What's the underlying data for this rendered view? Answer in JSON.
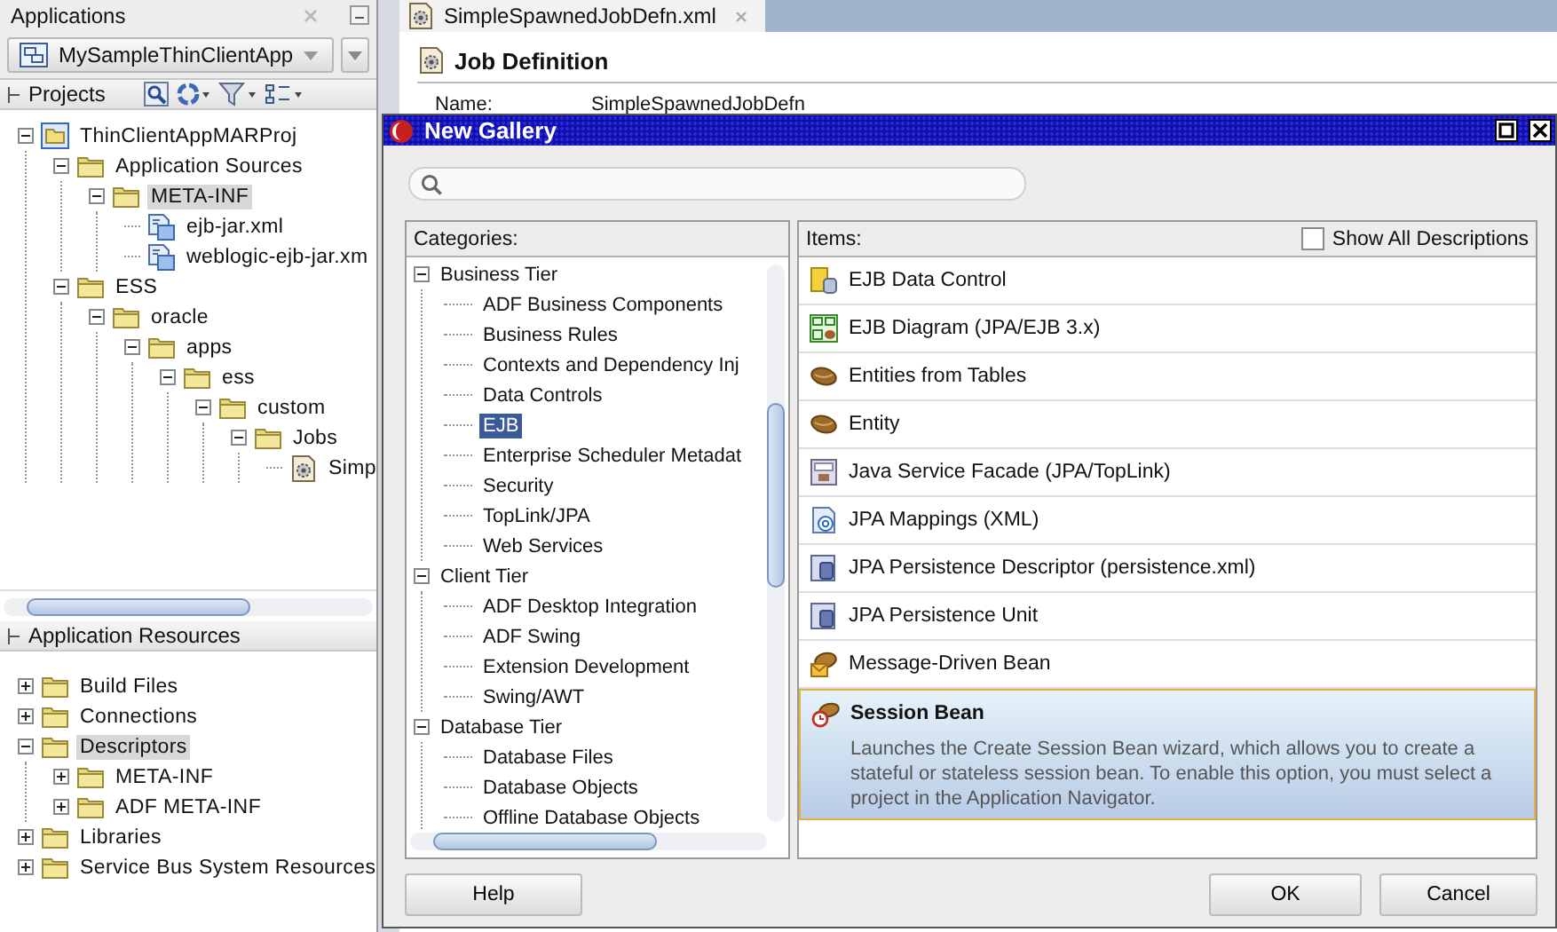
{
  "navigator": {
    "title": "Applications",
    "application": "MySampleThinClientApp",
    "projects_label": "Projects",
    "project_tree": [
      {
        "label": "ThinClientAppMARProj",
        "kind": "project",
        "expanded": true,
        "selected": false,
        "children": [
          {
            "label": "Application Sources",
            "kind": "folder",
            "expanded": true,
            "selected": false,
            "children": [
              {
                "label": "META-INF",
                "kind": "folder",
                "expanded": true,
                "selected": true,
                "children": [
                  {
                    "label": "ejb-jar.xml",
                    "kind": "xml",
                    "selected": false
                  },
                  {
                    "label": "weblogic-ejb-jar.xm",
                    "kind": "xml",
                    "selected": false
                  }
                ]
              }
            ]
          },
          {
            "label": "ESS",
            "kind": "folder",
            "expanded": true,
            "selected": false,
            "children": [
              {
                "label": "oracle",
                "kind": "folder",
                "expanded": true,
                "selected": false,
                "children": [
                  {
                    "label": "apps",
                    "kind": "folder",
                    "expanded": true,
                    "selected": false,
                    "children": [
                      {
                        "label": "ess",
                        "kind": "folder",
                        "expanded": true,
                        "selected": false,
                        "children": [
                          {
                            "label": "custom",
                            "kind": "folder",
                            "expanded": true,
                            "selected": false,
                            "children": [
                              {
                                "label": "Jobs",
                                "kind": "folder",
                                "expanded": true,
                                "selected": false,
                                "children": [
                                  {
                                    "label": "Simp",
                                    "kind": "job",
                                    "selected": false
                                  }
                                ]
                              }
                            ]
                          }
                        ]
                      }
                    ]
                  }
                ]
              }
            ]
          }
        ]
      }
    ],
    "resources_label": "Application Resources",
    "resource_tree": [
      {
        "label": "Build Files",
        "kind": "folder",
        "expanded": false,
        "selected": false
      },
      {
        "label": "Connections",
        "kind": "folder",
        "expanded": false,
        "selected": false
      },
      {
        "label": "Descriptors",
        "kind": "folder",
        "expanded": true,
        "selected": true,
        "children": [
          {
            "label": "META-INF",
            "kind": "folder",
            "expanded": false,
            "selected": false
          },
          {
            "label": "ADF META-INF",
            "kind": "folder",
            "expanded": false,
            "selected": false
          }
        ]
      },
      {
        "label": "Libraries",
        "kind": "folder",
        "expanded": false,
        "selected": false
      },
      {
        "label": "Service Bus System Resources",
        "kind": "folder",
        "expanded": false,
        "selected": false
      }
    ]
  },
  "editor": {
    "tab": "SimpleSpawnedJobDefn.xml",
    "heading": "Job Definition",
    "field_label": "Name:",
    "field_value": "SimpleSpawnedJobDefn"
  },
  "dialog": {
    "title": "New Gallery",
    "categories_label": "Categories:",
    "items_label": "Items:",
    "show_all": {
      "label": "Show All Descriptions",
      "checked": false
    },
    "categories": [
      {
        "label": "Business Tier",
        "expanded": true,
        "selected": false,
        "children": [
          {
            "label": "ADF Business Components",
            "selected": false
          },
          {
            "label": "Business Rules",
            "selected": false
          },
          {
            "label": "Contexts and Dependency Inj",
            "selected": false
          },
          {
            "label": "Data Controls",
            "selected": false
          },
          {
            "label": "EJB",
            "selected": true
          },
          {
            "label": "Enterprise Scheduler Metadat",
            "selected": false
          },
          {
            "label": "Security",
            "selected": false
          },
          {
            "label": "TopLink/JPA",
            "selected": false
          },
          {
            "label": "Web Services",
            "selected": false
          }
        ]
      },
      {
        "label": "Client Tier",
        "expanded": true,
        "selected": false,
        "children": [
          {
            "label": "ADF Desktop Integration",
            "selected": false
          },
          {
            "label": "ADF Swing",
            "selected": false
          },
          {
            "label": "Extension Development",
            "selected": false
          },
          {
            "label": "Swing/AWT",
            "selected": false
          }
        ]
      },
      {
        "label": "Database Tier",
        "expanded": true,
        "selected": false,
        "children": [
          {
            "label": "Database Files",
            "selected": false
          },
          {
            "label": "Database Objects",
            "selected": false
          },
          {
            "label": "Offline Database Objects",
            "selected": false
          }
        ]
      }
    ],
    "items": [
      {
        "label": "EJB Data Control",
        "kind": "datacontrol",
        "selected": false
      },
      {
        "label": "EJB Diagram (JPA/EJB 3.x)",
        "kind": "diagram",
        "selected": false
      },
      {
        "label": "Entities from Tables",
        "kind": "entity",
        "selected": false
      },
      {
        "label": "Entity",
        "kind": "entity",
        "selected": false
      },
      {
        "label": "Java Service Facade (JPA/TopLink)",
        "kind": "facade",
        "selected": false
      },
      {
        "label": "JPA Mappings (XML)",
        "kind": "mapping",
        "selected": false
      },
      {
        "label": "JPA Persistence Descriptor (persistence.xml)",
        "kind": "persistence",
        "selected": false
      },
      {
        "label": "JPA Persistence Unit",
        "kind": "persistence",
        "selected": false
      },
      {
        "label": "Message-Driven Bean",
        "kind": "mdb",
        "selected": false
      },
      {
        "label": "Session Bean",
        "kind": "sessionbean",
        "selected": true,
        "description": "Launches the Create Session Bean wizard, which allows you to create a stateful or stateless session bean. To enable this option, you must select a project in the Application Navigator."
      }
    ],
    "buttons": [
      {
        "label": "Help",
        "kind": "help"
      },
      {
        "label": "OK",
        "kind": "ok"
      },
      {
        "label": "Cancel",
        "kind": "cancel"
      }
    ]
  }
}
